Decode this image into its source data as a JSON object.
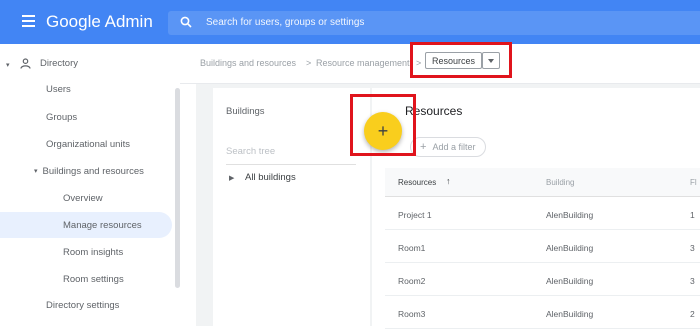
{
  "app": {
    "title": "Google Admin"
  },
  "search": {
    "placeholder": "Search for users, groups or settings"
  },
  "sidebar": {
    "directory_label": "Directory",
    "items": [
      {
        "label": "Users"
      },
      {
        "label": "Groups"
      },
      {
        "label": "Organizational units"
      },
      {
        "label": "Buildings and resources"
      },
      {
        "label": "Overview"
      },
      {
        "label": "Manage resources"
      },
      {
        "label": "Room insights"
      },
      {
        "label": "Room settings"
      },
      {
        "label": "Directory settings"
      }
    ]
  },
  "breadcrumb": {
    "parts": [
      "Buildings and resources",
      "Resource management",
      "Resources"
    ],
    "separator": ">"
  },
  "buildings_panel": {
    "title": "Buildings",
    "search_placeholder": "Search tree",
    "tree_item": "All buildings"
  },
  "resources_panel": {
    "title": "Resources",
    "filter_label": "Add a filter",
    "columns": [
      "Resources",
      "Building",
      "Fl"
    ],
    "rows": [
      {
        "name": "Project 1",
        "building": "AlenBuilding",
        "floor": "1"
      },
      {
        "name": "Room1",
        "building": "AlenBuilding",
        "floor": "3"
      },
      {
        "name": "Room2",
        "building": "AlenBuilding",
        "floor": "3"
      },
      {
        "name": "Room3",
        "building": "AlenBuilding",
        "floor": "2"
      }
    ]
  },
  "fab": {
    "symbol": "+"
  },
  "colors": {
    "topbar": "#4285f4",
    "fab": "#f9ce1d",
    "highlight": "#e0141c",
    "active_nav": "#e8f0fe"
  }
}
